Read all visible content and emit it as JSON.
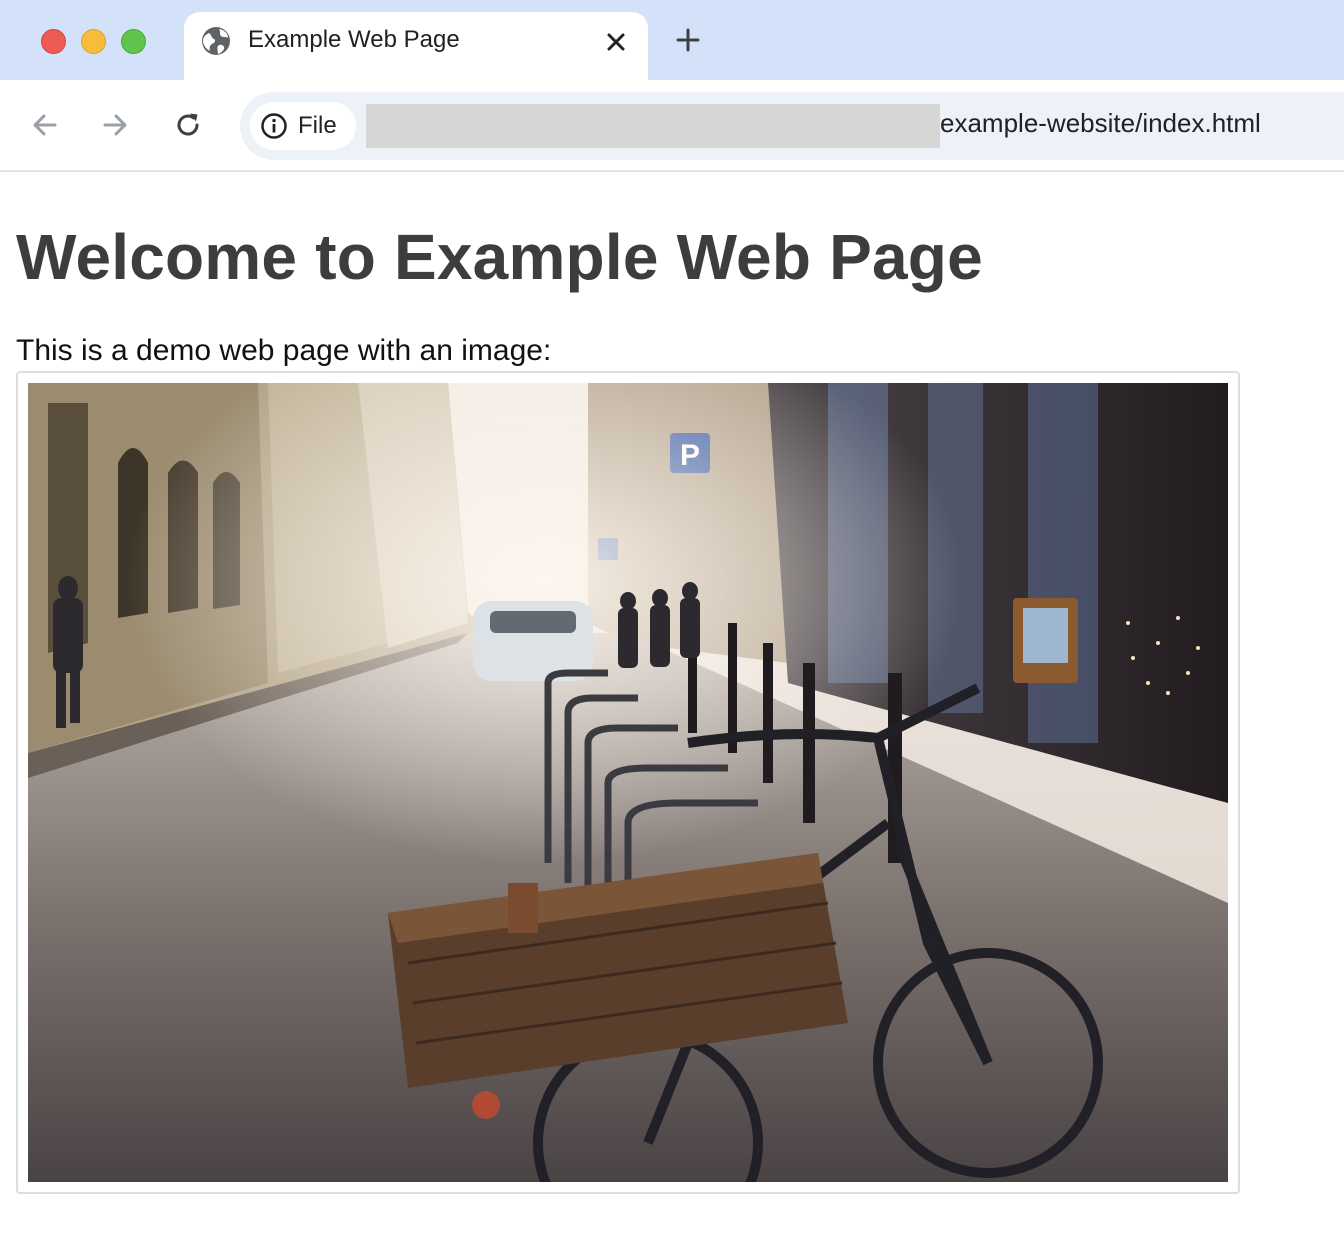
{
  "browser": {
    "tab": {
      "title": "Example Web Page",
      "favicon": "globe-icon"
    },
    "toolbar": {
      "back_icon": "arrow-left-icon",
      "forward_icon": "arrow-right-icon",
      "reload_icon": "reload-icon"
    },
    "address_bar": {
      "security_chip_label": "File",
      "security_icon": "info-icon",
      "url_visible": "example-website/index.html"
    }
  },
  "page": {
    "heading": "Welcome to Example Web Page",
    "intro": "This is a demo web page with an image:"
  },
  "colors": {
    "tabstrip": "#d3e2f8",
    "omnibox": "#edf1f8",
    "heading": "#3d3d3d",
    "close": "#ee5b55",
    "minimize": "#f5bd3b",
    "maximize": "#5ec54a"
  }
}
